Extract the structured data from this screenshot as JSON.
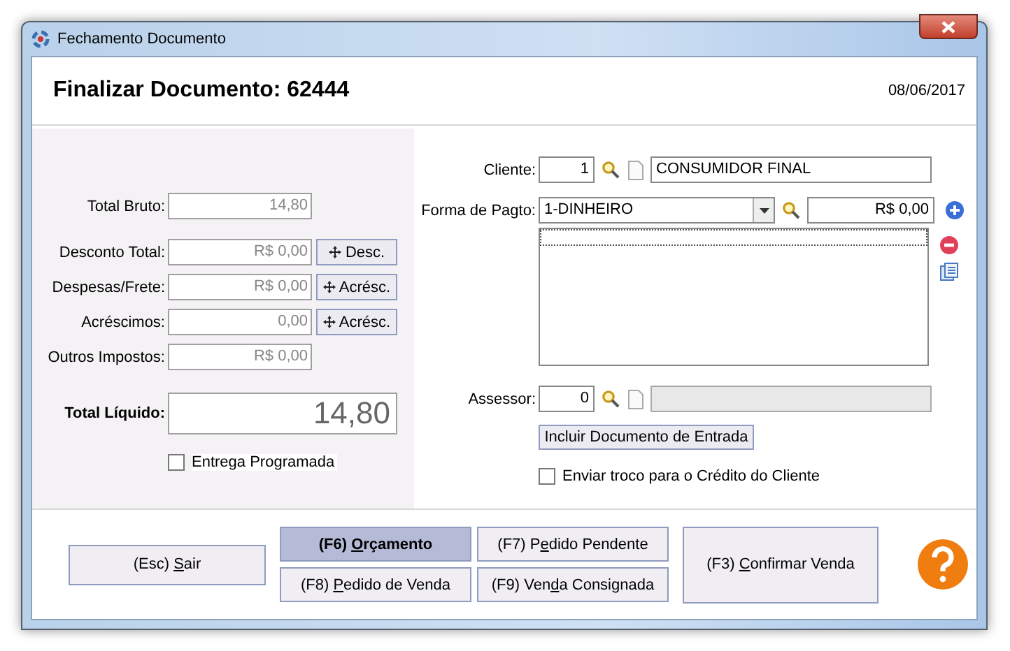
{
  "window": {
    "title": "Fechamento Documento"
  },
  "header": {
    "title": "Finalizar Documento: 62444",
    "date": "08/06/2017"
  },
  "totals": [
    {
      "label": "Total Bruto:",
      "value": "14,80"
    },
    {
      "label": "Desconto Total:",
      "value": "R$ 0,00",
      "button": "Desc."
    },
    {
      "label": "Despesas/Frete:",
      "value": "R$ 0,00",
      "button": "Acrésc."
    },
    {
      "label": "Acréscimos:",
      "value": "0,00",
      "button": "Acrésc."
    },
    {
      "label": "Outros Impostos:",
      "value": "R$ 0,00"
    }
  ],
  "total_liquido": {
    "label": "Total Líquido:",
    "value": "14,80"
  },
  "entrega_programada": {
    "label": "Entrega Programada",
    "checked": false
  },
  "cliente": {
    "label": "Cliente:",
    "code": "1",
    "name": "CONSUMIDOR FINAL",
    "disabled": false
  },
  "pagamento": {
    "label": "Forma de Pagto:",
    "selected_option": "1-DINHEIRO",
    "amount": "R$ 0,00"
  },
  "assessor": {
    "label": "Assessor:",
    "code": "0",
    "disabled": true
  },
  "incluir_button": "Incluir Documento de Entrada",
  "enviar_troco": {
    "label": "Enviar troco para o Crédito do Cliente",
    "checked": false
  },
  "buttons": [
    {
      "before": "(Esc) ",
      "key": "S",
      "after": "air",
      "kind": "exit",
      "selected": false
    },
    {
      "before": "(F6) ",
      "key": "O",
      "after": "rçamento",
      "kind": "grid",
      "selected": true
    },
    {
      "before": "(F7) P",
      "key": "e",
      "after": "dido Pendente",
      "kind": "grid",
      "selected": false
    },
    {
      "before": "(F8) ",
      "key": "P",
      "after": "edido de Venda",
      "kind": "grid",
      "selected": false
    },
    {
      "before": "(F9) Ven",
      "key": "d",
      "after": "a Consignada",
      "kind": "grid",
      "selected": false
    },
    {
      "before": "(F3) ",
      "key": "C",
      "after": "onfirmar Venda",
      "kind": "confirm",
      "selected": false
    }
  ]
}
